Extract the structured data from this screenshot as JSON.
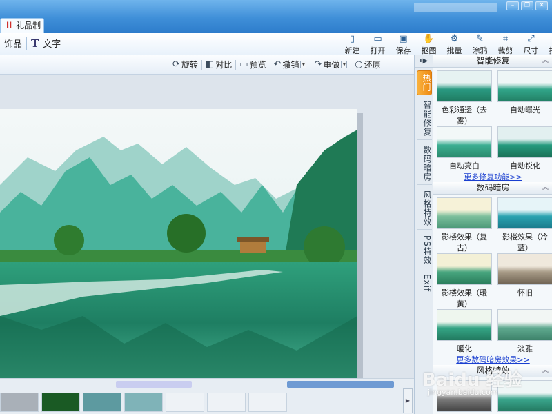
{
  "window": {
    "tab_label": "礼品制作",
    "tab_icon": "gift-icon",
    "buttons": [
      "minimize",
      "restore",
      "close"
    ]
  },
  "main_toolbar": {
    "left_items": [
      {
        "label": "饰品",
        "icon": "ornament-icon"
      },
      {
        "label": "文字",
        "icon": "text-T-icon"
      }
    ],
    "right_buttons": [
      {
        "label": "新建",
        "icon": "new-file-icon"
      },
      {
        "label": "打开",
        "icon": "open-folder-icon"
      },
      {
        "label": "保存",
        "icon": "save-disk-icon"
      },
      {
        "label": "抠图",
        "icon": "cutout-icon"
      },
      {
        "label": "批量",
        "icon": "batch-gear-icon"
      },
      {
        "label": "涂鸦",
        "icon": "doodle-icon"
      },
      {
        "label": "裁剪",
        "icon": "crop-icon"
      },
      {
        "label": "尺寸",
        "icon": "resize-icon"
      },
      {
        "label": "打印",
        "icon": "print-icon"
      }
    ]
  },
  "edit_toolbar": {
    "rotate": "旋转",
    "compare": "对比",
    "preview": "预览",
    "undo": "撤销",
    "redo": "重做",
    "restore": "还原"
  },
  "right_panel": {
    "vertical_tabs": [
      "热门",
      "智能修复",
      "数码暗房",
      "风格特效",
      "PS特效",
      "Exif"
    ],
    "active_tab": "热门",
    "sections": [
      {
        "title": "智能修复",
        "items": [
          "色彩通透（去雾）",
          "自动曝光",
          "自动亮白",
          "自动锐化"
        ],
        "more_link": "更多修复功能>>"
      },
      {
        "title": "数码暗房",
        "items": [
          "影楼效果（复古）",
          "影楼效果（冷蓝）",
          "影楼效果（暖黄）",
          "怀旧",
          "暖化",
          "淡雅"
        ],
        "more_link": "更多数码暗房效果>>"
      },
      {
        "title": "风格特效",
        "items": []
      }
    ]
  },
  "watermark": {
    "text": "Baidu 经验",
    "sub": "jingyan.baidu.com"
  },
  "colors": {
    "titlebar": "#3f8fd8",
    "active_tab": "#f29a22",
    "link": "#1a3fd0",
    "panel_bg": "#f4f8fb"
  }
}
